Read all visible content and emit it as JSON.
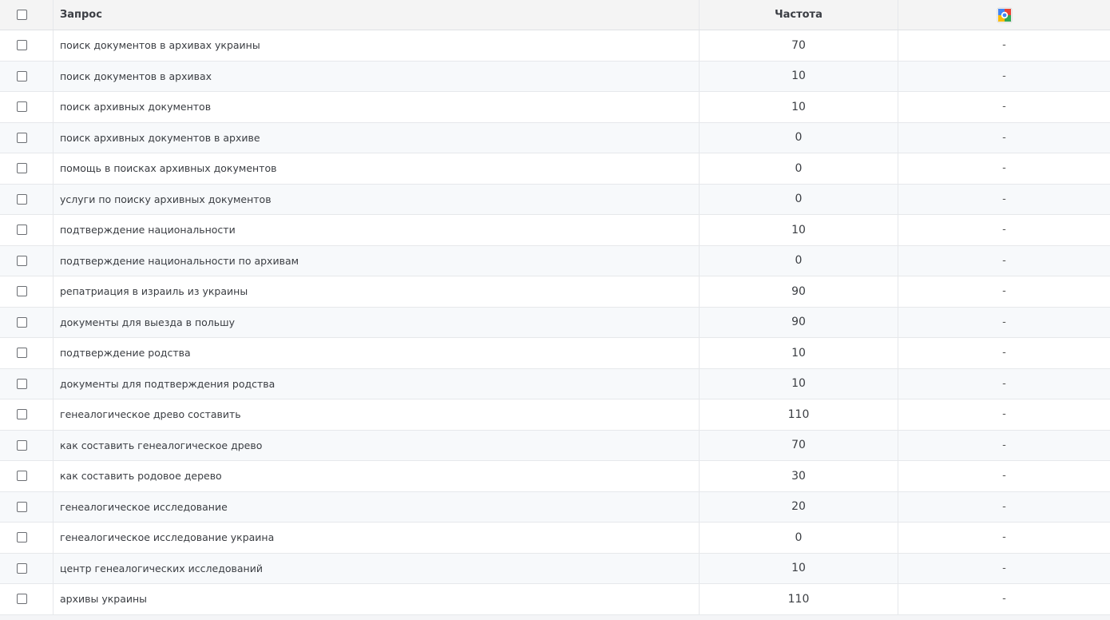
{
  "header": {
    "query": "Запрос",
    "frequency": "Частота",
    "engine_icon": "google-icon"
  },
  "rows": [
    {
      "query": "поиск документов в архивах украины",
      "frequency": "70",
      "g": "-"
    },
    {
      "query": "поиск документов в архивах",
      "frequency": "10",
      "g": "-"
    },
    {
      "query": "поиск архивных документов",
      "frequency": "10",
      "g": "-"
    },
    {
      "query": "поиск архивных документов в архиве",
      "frequency": "0",
      "g": "-"
    },
    {
      "query": "помощь в поисках архивных документов",
      "frequency": "0",
      "g": "-"
    },
    {
      "query": "услуги по поиску архивных документов",
      "frequency": "0",
      "g": "-"
    },
    {
      "query": "подтверждение национальности",
      "frequency": "10",
      "g": "-"
    },
    {
      "query": "подтверждение национальности по архивам",
      "frequency": "0",
      "g": "-"
    },
    {
      "query": "репатриация в израиль из украины",
      "frequency": "90",
      "g": "-"
    },
    {
      "query": "документы для выезда в польшу",
      "frequency": "90",
      "g": "-"
    },
    {
      "query": "подтверждение родства",
      "frequency": "10",
      "g": "-"
    },
    {
      "query": "документы для подтверждения родства",
      "frequency": "10",
      "g": "-"
    },
    {
      "query": "генеалогическое древо составить",
      "frequency": "110",
      "g": "-"
    },
    {
      "query": "как составить генеалогическое древо",
      "frequency": "70",
      "g": "-"
    },
    {
      "query": "как составить родовое дерево",
      "frequency": "30",
      "g": "-"
    },
    {
      "query": "генеалогическое исследование",
      "frequency": "20",
      "g": "-"
    },
    {
      "query": "генеалогическое исследование украина",
      "frequency": "0",
      "g": "-"
    },
    {
      "query": "центр генеалогических исследований",
      "frequency": "10",
      "g": "-"
    },
    {
      "query": "архивы украины",
      "frequency": "110",
      "g": "-"
    }
  ],
  "colors": {
    "google_blue": "#4285f4",
    "google_red": "#ea4335",
    "google_yellow": "#fbbc05",
    "google_green": "#34a853"
  }
}
